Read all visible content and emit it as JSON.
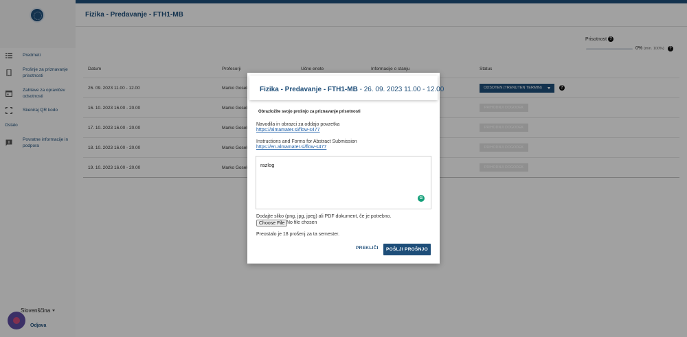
{
  "sidebar": {
    "items": [
      {
        "label": "Predmeti"
      },
      {
        "label": "Prošnje za priznavanje prisotnosti"
      },
      {
        "label": "Zahteve za opravičev odsotnosti"
      },
      {
        "label": "Skeniraj QR kodo"
      },
      {
        "label": "Povratne informacije in podpora"
      }
    ],
    "section": "Ostalo",
    "language": "Slovenščina",
    "logout": "Odjava"
  },
  "header": {
    "title": "Fizika - Predavanje - FTH1-MB"
  },
  "attendance": {
    "label": "Prisotnost",
    "value": "0%",
    "min_note": "(min. 100%)",
    "progress": 0
  },
  "table": {
    "headers": [
      "Datum",
      "Profesorji",
      "Učne enote",
      "Informacije o stanju",
      "Status"
    ],
    "rows": [
      {
        "date": "26. 09. 2023 11.00 - 12.00",
        "prof": "Marko Gosek",
        "status": "ODSOTEN (TRENUTEN TERMIN)"
      },
      {
        "date": "16. 10. 2023 16.00 - 20.00",
        "prof": "Marko Gosek",
        "status": "PRIHODNJI DOGODEK"
      },
      {
        "date": "17. 10. 2023 16.00 - 20.00",
        "prof": "Marko Gosek",
        "status": "PRIHODNJI DOGODEK"
      },
      {
        "date": "18. 10. 2023 16.00 - 20.00",
        "prof": "Marko Gosek",
        "status": "PRIHODNJI DOGODEK"
      },
      {
        "date": "19. 10. 2023 16.00 - 20.00",
        "prof": "Marko Gosek",
        "status": "PRIHODNJI DOGODEK"
      }
    ]
  },
  "modal": {
    "title": "Fizika - Predavanje - FTH1-MB",
    "date": " - 26. 09. 2023 11.00 - 12.00",
    "explain": "Obrazložite svojo prošnjo za priznavanje prisotnosti",
    "instr_sl": "Navodila in obrazci za oddajo povzetka",
    "link_sl": "https://almamater.si/flow-s477",
    "instr_en": "Instructions and Forms for Abstract Submission",
    "link_en": "https://en.almamater.si/flow-s477",
    "reason_value": "razlog",
    "attach_hint": "Dodajte sliko (png, jpg, jpeg) ali PDF dokument, če je potrebno.",
    "file_button": "Choose File",
    "file_none": "No file chosen",
    "remaining": "Preostalo je 18 prošenj za ta semester.",
    "cancel": "PREKLIČI",
    "send": "POŠLJI PROŠNJO"
  },
  "colors": {
    "brand": "#1e4e79",
    "link": "#1e5fa8"
  }
}
